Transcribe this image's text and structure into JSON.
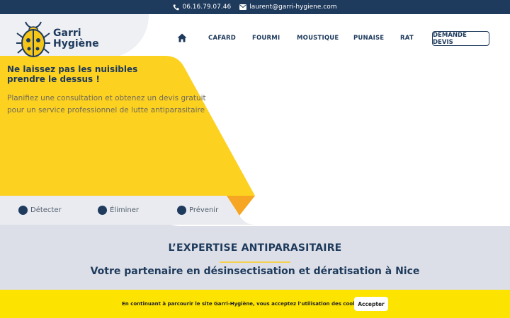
{
  "topbar": {
    "phone": "06.16.79.07.46",
    "email": "laurent@garri-hygiene.com",
    "phone_icon": "phone-icon",
    "email_icon": "envelope-icon"
  },
  "logo": {
    "line1": "Garri",
    "line2": "Hygiène",
    "icon": "beetle-icon"
  },
  "nav": {
    "home_icon": "home-icon",
    "items": [
      {
        "label": "CAFARD"
      },
      {
        "label": "FOURMI"
      },
      {
        "label": "MOUSTIQUE"
      },
      {
        "label": "PUNAISE"
      },
      {
        "label": "RAT"
      }
    ],
    "cta": "DEMANDE DEVIS"
  },
  "hero": {
    "title_line1": "Ne laissez pas les nuisibles",
    "title_line2": "prendre le dessus !",
    "subtitle_line1": "Planifiez une consultation et obtenez un devis gratuit",
    "subtitle_line2": "pour un service professionnel de lutte antiparasitaire"
  },
  "steps": [
    {
      "label": "Détecter"
    },
    {
      "label": "Éliminer"
    },
    {
      "label": "Prévenir"
    }
  ],
  "section": {
    "title": "L’EXPERTISE ANTIPARASITAIRE",
    "subtitle": "Votre partenaire en désinsectisation et dératisation à Nice"
  },
  "cookie": {
    "text": "En continuant à parcourir le site Garri-Hygiène, vous acceptez l’utilisation des cookies.",
    "button": "Accepter"
  },
  "colors": {
    "navy": "#1e3a5c",
    "yellow": "#fdd11f",
    "cookie_yellow": "#fde300",
    "grey": "#dcdfe7"
  }
}
